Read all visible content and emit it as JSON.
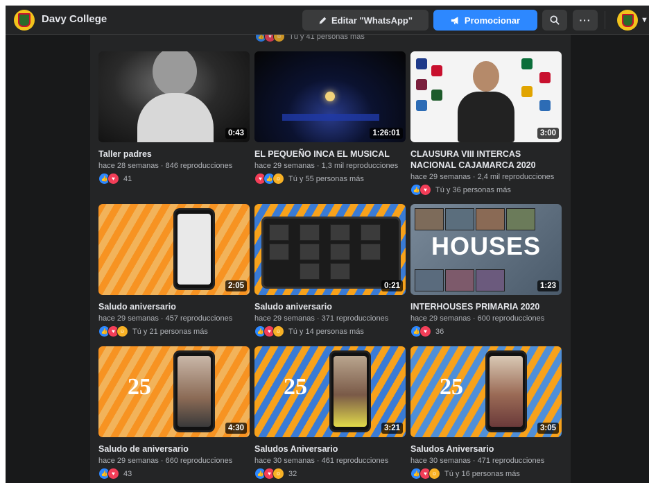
{
  "topbar": {
    "page_name": "Davy College",
    "edit_label": "Editar \"WhatsApp\"",
    "promote_label": "Promocionar",
    "more_label": "···"
  },
  "prev_row": {
    "reactions_text": "Tú y 41 personas más"
  },
  "videos": [
    {
      "title": "Taller padres",
      "meta": "hace 28 semanas · 846 reproducciones",
      "duration": "0:43",
      "reactions": [
        "like",
        "love"
      ],
      "reactions_text": "41"
    },
    {
      "title": "EL PEQUEÑO INCA EL MUSICAL",
      "meta": "hace 29 semanas · 1,3 mil reproducciones",
      "duration": "1:26:01",
      "reactions": [
        "love",
        "like",
        "care"
      ],
      "reactions_text": "Tú y 55 personas más"
    },
    {
      "title": "CLAUSURA VIII INTERCAS NACIONAL CAJAMARCA 2020",
      "meta": "hace 29 semanas · 2,4 mil reproducciones",
      "duration": "3:00",
      "reactions": [
        "like",
        "love"
      ],
      "reactions_text": "Tú y 36 personas más"
    },
    {
      "title": "Saludo aniversario",
      "meta": "hace 29 semanas · 457 reproducciones",
      "duration": "2:05",
      "reactions": [
        "like",
        "love",
        "care"
      ],
      "reactions_text": "Tú y 21 personas más"
    },
    {
      "title": "Saludo aniversario",
      "meta": "hace 29 semanas · 371 reproducciones",
      "duration": "0:21",
      "reactions": [
        "like",
        "love",
        "care"
      ],
      "reactions_text": "Tú y 14 personas más"
    },
    {
      "title": "INTERHOUSES PRIMARIA 2020",
      "meta": "hace 29 semanas · 600 reproducciones",
      "duration": "1:23",
      "reactions": [
        "like",
        "love"
      ],
      "reactions_text": "36"
    },
    {
      "title": "Saludo de aniversario",
      "meta": "hace 29 semanas · 660 reproducciones",
      "duration": "4:30",
      "reactions": [
        "like",
        "love"
      ],
      "reactions_text": "43"
    },
    {
      "title": "Saludos Aniversario",
      "meta": "hace 30 semanas · 461 reproducciones",
      "duration": "3:21",
      "reactions": [
        "like",
        "love",
        "care"
      ],
      "reactions_text": "32"
    },
    {
      "title": "Saludos Aniversario",
      "meta": "hace 30 semanas · 471 reproducciones",
      "duration": "3:05",
      "reactions": [
        "like",
        "love",
        "care"
      ],
      "reactions_text": "Tú y 16 personas más"
    }
  ],
  "thumb_text": {
    "houses": "HOUSES",
    "anniv": "25"
  }
}
